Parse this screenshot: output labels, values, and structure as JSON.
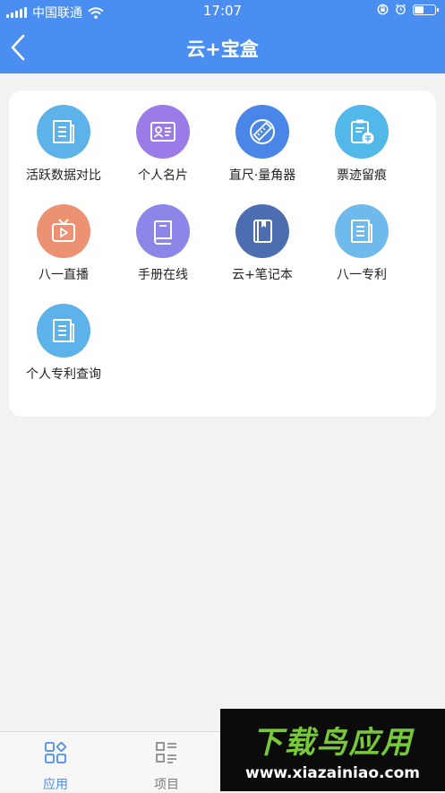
{
  "status_bar": {
    "carrier": "中国联通",
    "time": "17:07"
  },
  "header": {
    "title": "云+宝盒"
  },
  "apps": [
    {
      "label": "活跃数据对比",
      "icon": "document-icon",
      "color": "#5db2ea"
    },
    {
      "label": "个人名片",
      "icon": "id-card-icon",
      "color": "#9b7be8"
    },
    {
      "label": "直尺·量角器",
      "icon": "ruler-icon",
      "color": "#4a86e8"
    },
    {
      "label": "票迹留痕",
      "icon": "clipboard-ticket-icon",
      "color": "#52b8ea"
    },
    {
      "label": "八一直播",
      "icon": "tv-play-icon",
      "color": "#ec9273"
    },
    {
      "label": "手册在线",
      "icon": "book-icon",
      "color": "#8b86e8"
    },
    {
      "label": "云+笔记本",
      "icon": "notebook-icon",
      "color": "#4d6db1"
    },
    {
      "label": "八一专利",
      "icon": "document-icon",
      "color": "#6fbaec"
    },
    {
      "label": "个人专利查询",
      "icon": "document-icon",
      "color": "#5db2ea"
    }
  ],
  "tabbar": {
    "tabs": [
      {
        "label": "应用",
        "icon": "apps-grid-icon",
        "active": true
      },
      {
        "label": "项目",
        "icon": "project-icon",
        "active": false
      }
    ]
  },
  "watermark": {
    "brand": "下载鸟应用",
    "url": "www.xiazainiao.com"
  },
  "colors": {
    "primary": "#4b8ef1",
    "background": "#f2f2f4"
  }
}
